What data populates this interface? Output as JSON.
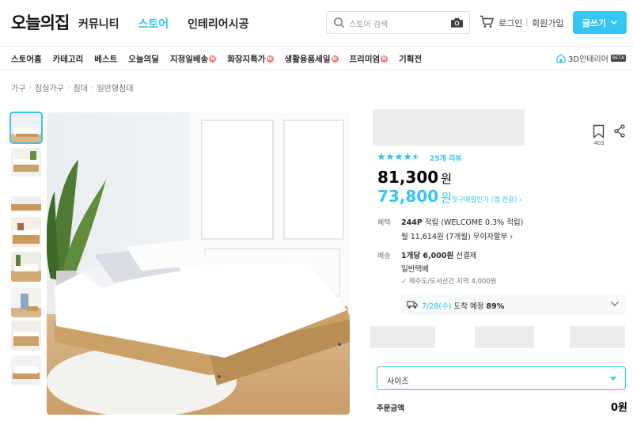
{
  "header": {
    "logo": "오늘의집",
    "nav": [
      "커뮤니티",
      "스토어",
      "인테리어시공"
    ],
    "active_nav": "스토어",
    "search_placeholder": "스토어 검색",
    "login": "로그인",
    "separator": "|",
    "signup": "회원가입",
    "write_button": "글쓰기",
    "icons": [
      "search-icon",
      "camera-icon",
      "cart-icon",
      "chevron-down-icon"
    ]
  },
  "subnav": {
    "items": [
      {
        "label": "스토어홈",
        "new": false
      },
      {
        "label": "카테고리",
        "new": false
      },
      {
        "label": "베스트",
        "new": false
      },
      {
        "label": "오늘의딜",
        "new": false
      },
      {
        "label": "지정일배송",
        "new": true
      },
      {
        "label": "화장지특가",
        "new": true
      },
      {
        "label": "생활용품세일",
        "new": true
      },
      {
        "label": "프리미엄",
        "new": true
      },
      {
        "label": "기획전",
        "new": false
      }
    ],
    "badge_letter": "N",
    "threed_label": "3D인테리어",
    "beta": "BETA"
  },
  "breadcrumb": [
    "가구",
    "침실가구",
    "침대",
    "일반형침대"
  ],
  "product": {
    "bookmark_count": "403",
    "rating": 4.5,
    "reviews": "25개 리뷰",
    "price": "81,300",
    "discount_price": "73,800",
    "currency": "원",
    "discount_note": "첫구매할인가 (앱 전용) ›",
    "benefit_label": "혜택",
    "benefit_points": "244P",
    "benefit_points_suffix": " 적립 (WELCOME 0.3% 적립)",
    "installment": "월 11,614원 (7개월) 무이자할부 ›",
    "shipping_label": "배송",
    "shipping_fee": "1개당 6,000원",
    "shipping_fee_suffix": " 선결제",
    "shipping_type": "일반택배",
    "shipping_note": "✓ 제주도/도서산간 지역 4,000원",
    "arrival_date": "7/28(수)",
    "arrival_text": " 도착 예정 ",
    "arrival_rate": "89%",
    "size_placeholder": "사이즈",
    "order_label": "주문금액",
    "order_total": "0원"
  },
  "colors": {
    "accent": "#35c5f0",
    "new_badge": "#ff7777",
    "star": "#35c5f0"
  }
}
